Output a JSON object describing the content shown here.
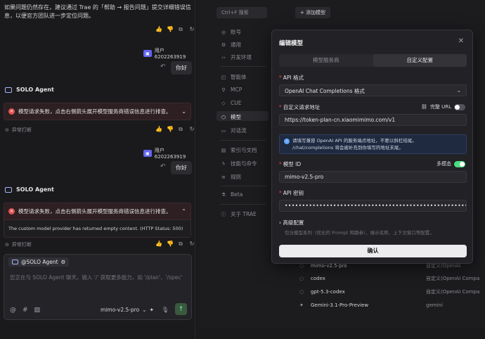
{
  "chat": {
    "first_message_line1": "如果问题仍然存在，建议通过 Trae 的「帮助 → 报告问题」提交详细错误信",
    "first_message_line2": "息，以便官方团队进一步定位问题。",
    "user_name": "用户6202263919",
    "user_message": "你好",
    "agent_name": "SOLO Agent",
    "error_text": "模型请求失败，点击右侧箭头展开模型服务商错误信息进行排查。",
    "stopped_label": "异常打断",
    "error_detail": "The custom model provider has returned empty content. (HTTP Status: 500)"
  },
  "composer": {
    "agent_tag": "@SOLO Agent",
    "placeholder": "您正在与 SOLO Agent 聊天，输入 '/' 获取更多能力，如 '/plan'、'/spec'",
    "model": "mimo-v2.5-pro"
  },
  "settings": {
    "search_placeholder": "Ctrl+F 搜索",
    "add_model": "+ 添加模型",
    "nav": {
      "account": "账号",
      "general": "通用",
      "dev_env": "开发环境",
      "agents": "智能体",
      "mcp": "MCP",
      "cue": "CUE",
      "models": "模型",
      "conversation": "对话流",
      "index": "索引与文档",
      "skills": "技能与命令",
      "rules": "规则",
      "beta": "Beta",
      "about": "关于 TRAE"
    },
    "models": [
      {
        "name": "mimo-v2.5-pro",
        "provider": "自定义(OpenAI"
      },
      {
        "name": "codex",
        "provider": "自定义(OpenAI Compa"
      },
      {
        "name": "gpt-5.3-codex",
        "provider": "自定义(OpenAI Compa"
      },
      {
        "name": "Gemini-3.1-Pro-Preview",
        "provider": "gemini"
      }
    ]
  },
  "modal": {
    "title": "编辑模型",
    "tab_service": "模型服务商",
    "tab_custom": "自定义配置",
    "api_format_label": "API 格式",
    "api_format_value": "OpenAI Chat Completions 格式",
    "url_label": "自定义请求地址",
    "full_url_label": "完整 URL",
    "url_value": "https://token-plan-cn.xiaomimimo.com/v1",
    "info_line1": "请填写兼容 OpenAI API 的服务端点地址，不要以斜杠结尾。",
    "info_line2": "/chat/completions 将会被补充到你填写的地址末尾。",
    "model_id_label": "模型 ID",
    "multimodal_label": "多模态",
    "model_id_value": "mimo-v2.5-pro",
    "api_key_label": "API 密钥",
    "api_key_value": "••••••••••••••••••••••••••••••••••••••••••••••••••••••••••••••••",
    "advanced_label": "高级配置",
    "advanced_desc": "包含模型系列（优化的 Prompt 和路参）、展示名称、上下文窗口等配置。",
    "confirm_label": "确认"
  }
}
